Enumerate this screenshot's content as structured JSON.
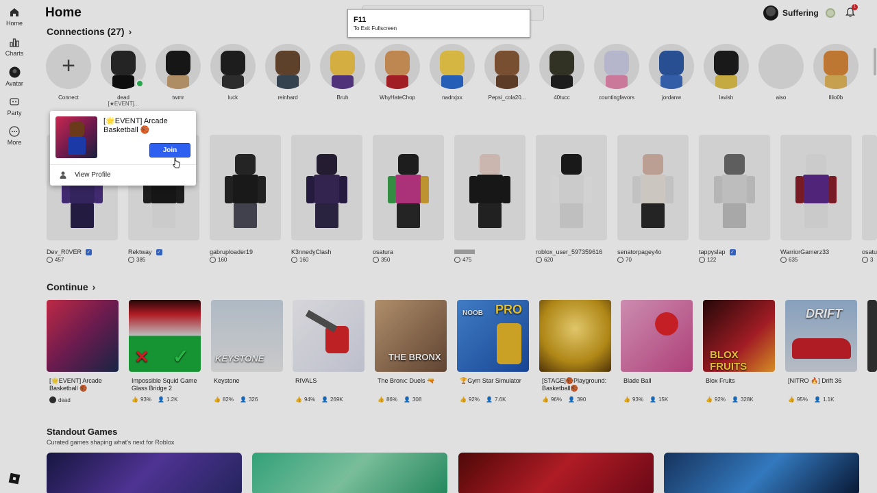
{
  "nav": {
    "items": [
      {
        "label": "Home",
        "icon": "home-icon"
      },
      {
        "label": "Charts",
        "icon": "charts-icon"
      },
      {
        "label": "Avatar",
        "icon": "avatar-icon"
      },
      {
        "label": "Party",
        "icon": "party-icon"
      },
      {
        "label": "More",
        "icon": "more-icon"
      }
    ]
  },
  "header": {
    "title": "Home",
    "username": "Suffering",
    "notifications": "1"
  },
  "toast": {
    "key": "F11",
    "message": "To Exit Fullscreen"
  },
  "connections": {
    "title": "Connections (27)",
    "add_label": "Connect",
    "people": [
      {
        "name": "dead",
        "status": "[★EVENT]..."
      },
      {
        "name": "twmr"
      },
      {
        "name": "luck"
      },
      {
        "name": "reinhard"
      },
      {
        "name": "Bruh"
      },
      {
        "name": "WhyHateChop"
      },
      {
        "name": "nadrxjxx"
      },
      {
        "name": "Pepsi_cola20..."
      },
      {
        "name": "40tucc"
      },
      {
        "name": "countingfavors"
      },
      {
        "name": "jordanw"
      },
      {
        "name": "lavish"
      },
      {
        "name": "aiso"
      },
      {
        "name": "lllio0b"
      }
    ]
  },
  "popup": {
    "game": "[🌟EVENT] Arcade Basketball 🏀",
    "join_label": "Join",
    "view_profile_label": "View Profile"
  },
  "avatars": [
    {
      "name": "Dev_R0VER",
      "robux": "457",
      "verified": true
    },
    {
      "name": "Rektway",
      "robux": "385",
      "verified": true
    },
    {
      "name": "gabruploader19",
      "robux": "160"
    },
    {
      "name": "K3nnedyClash",
      "robux": "160"
    },
    {
      "name": "osatura",
      "robux": "350"
    },
    {
      "name": "lllllllllllllll",
      "robux": "475"
    },
    {
      "name": "roblox_user_597359616",
      "robux": "620"
    },
    {
      "name": "senatorpagey4o",
      "robux": "70"
    },
    {
      "name": "tappyslap",
      "robux": "122",
      "verified": true
    },
    {
      "name": "WarriorGamerz33",
      "robux": "635"
    },
    {
      "name": "osatu",
      "robux": "3"
    }
  ],
  "continue": {
    "title": "Continue",
    "games": [
      {
        "title": "[🌟EVENT] Arcade Basketball 🏀",
        "friend": "dead"
      },
      {
        "title": "Impossible Squid Game Glass Bridge 2",
        "rating": "93%",
        "players": "1.2K"
      },
      {
        "title": "Keystone",
        "rating": "82%",
        "players": "326"
      },
      {
        "title": "RIVALS",
        "rating": "94%",
        "players": "269K"
      },
      {
        "title": "The Bronx: Duels 🔫",
        "rating": "86%",
        "players": "308"
      },
      {
        "title": "🏆Gym Star Simulator",
        "rating": "92%",
        "players": "7.6K"
      },
      {
        "title": "[STAGE]🏀Playground: Basketball🏀",
        "rating": "96%",
        "players": "390"
      },
      {
        "title": "Blade Ball",
        "rating": "93%",
        "players": "15K"
      },
      {
        "title": "Blox Fruits",
        "rating": "92%",
        "players": "328K"
      },
      {
        "title": "[NITRO 🔥] Drift 36",
        "rating": "95%",
        "players": "1.1K"
      }
    ],
    "tile_texts": {
      "bronx": "THE BRONX",
      "noob": "NOOB",
      "pro": "PRO",
      "drift": "DRIFT",
      "keystone": "KEYSTONE",
      "blox": "BLOX FRUITS"
    }
  },
  "standout": {
    "title": "Standout Games",
    "subtitle": "Curated games shaping what's next for Roblox"
  }
}
